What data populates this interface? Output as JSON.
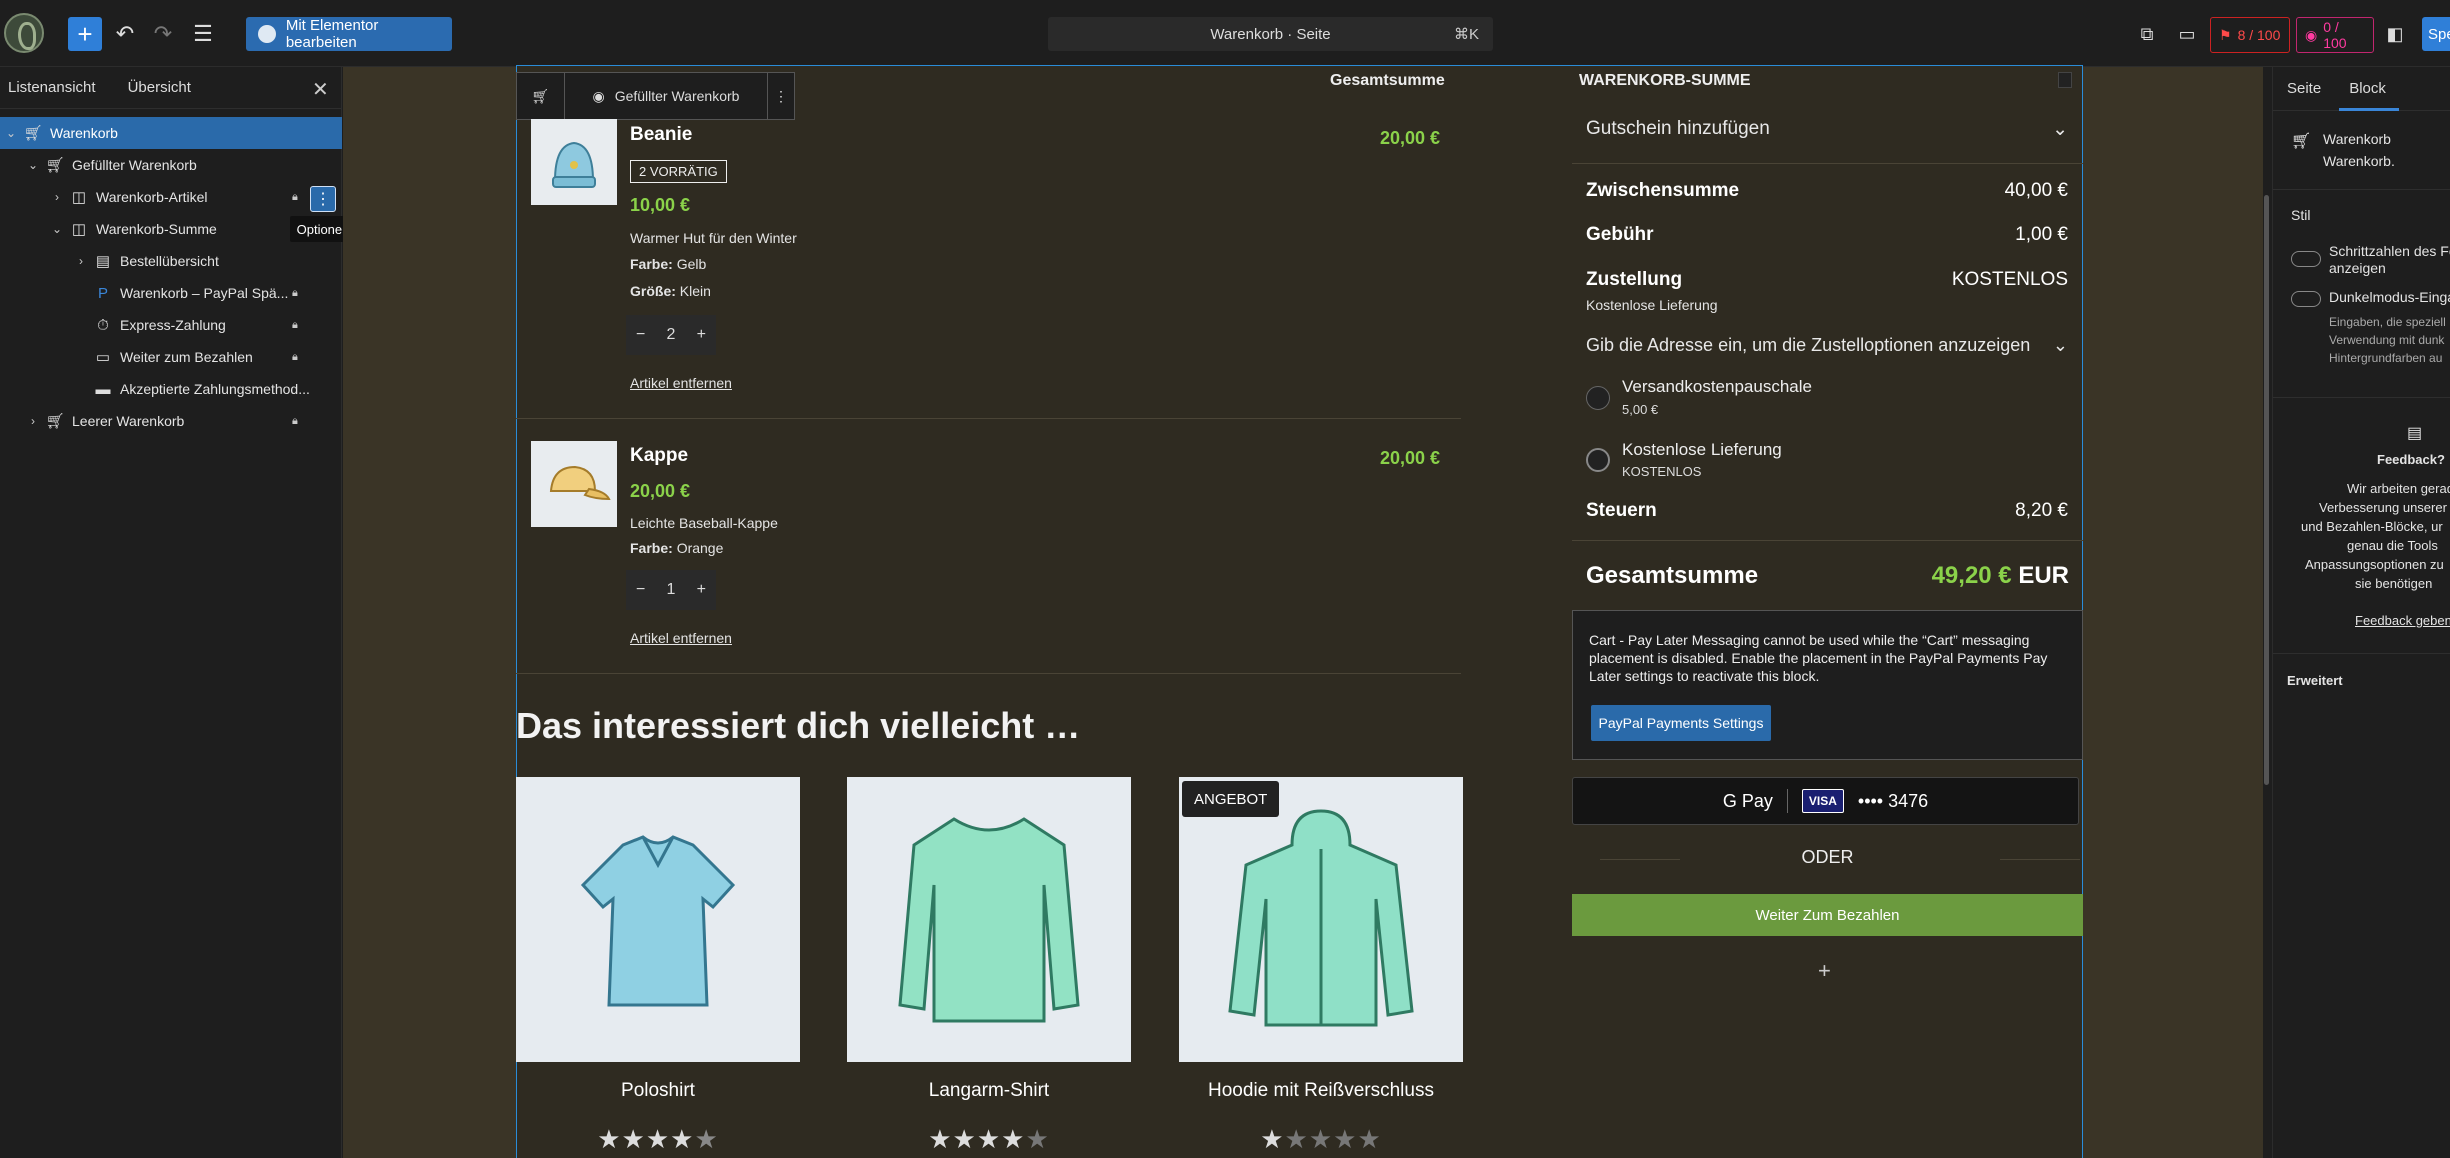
{
  "topbar": {
    "edit_button": "Mit Elementor bearbeiten",
    "document_title": "Warenkorb · Seite",
    "shortcut": "⌘K",
    "score_one": "8 / 100",
    "score_two": "0 / 100",
    "save_button": "Spe"
  },
  "left_sidebar": {
    "tab_list": "Listenansicht",
    "tab_overview": "Übersicht",
    "tooltip": "Optionen",
    "tree": [
      {
        "label": "Warenkorb"
      },
      {
        "label": "Gefüllter Warenkorb"
      },
      {
        "label": "Warenkorb-Artikel"
      },
      {
        "label": "Warenkorb-Summe"
      },
      {
        "label": "Bestellübersicht"
      },
      {
        "label": "Warenkorb – PayPal Spä..."
      },
      {
        "label": "Express-Zahlung"
      },
      {
        "label": "Weiter zum Bezahlen"
      },
      {
        "label": "Akzeptierte Zahlungsmethod..."
      },
      {
        "label": "Leerer Warenkorb"
      }
    ]
  },
  "block_toolbar": {
    "label": "Gefüllter Warenkorb"
  },
  "cart": {
    "column_total": "Gesamtsumme",
    "items": [
      {
        "name": "Beanie",
        "stock": "2 VORRÄTIG",
        "price": "10,00 €",
        "description": "Warmer Hut für den Winter",
        "attr1_label": "Farbe:",
        "attr1_value": "Gelb",
        "attr2_label": "Größe:",
        "attr2_value": "Klein",
        "qty": "2",
        "line_total": "20,00 €",
        "remove": "Artikel entfernen"
      },
      {
        "name": "Kappe",
        "price": "20,00 €",
        "description": "Leichte Baseball-Kappe",
        "attr1_label": "Farbe:",
        "attr1_value": "Orange",
        "qty": "1",
        "line_total": "20,00 €",
        "remove": "Artikel entfernen"
      }
    ]
  },
  "recommendations": {
    "title": "Das interessiert dich vielleicht …",
    "sale_badge": "ANGEBOT",
    "products": [
      {
        "name": "Poloshirt",
        "rating": 4.5
      },
      {
        "name": "Langarm-Shirt",
        "rating": 4
      },
      {
        "name": "Hoodie mit Reißverschluss",
        "rating": 1
      }
    ]
  },
  "totals": {
    "heading": "WARENKORB-SUMME",
    "coupon": "Gutschein hinzufügen",
    "subtotal_label": "Zwischensumme",
    "subtotal_value": "40,00 €",
    "fee_label": "Gebühr",
    "fee_value": "1,00 €",
    "shipping_label": "Zustellung",
    "shipping_value": "KOSTENLOS",
    "shipping_sub": "Kostenlose Lieferung",
    "address_prompt": "Gib die Adresse ein, um die Zustelloptionen anzuzeigen",
    "option1_label": "Versandkostenpauschale",
    "option1_price": "5,00 €",
    "option2_label": "Kostenlose Lieferung",
    "option2_price": "KOSTENLOS",
    "tax_label": "Steuern",
    "tax_value": "8,20 €",
    "grand_label": "Gesamtsumme",
    "grand_value": "49,20 €",
    "grand_currency": "EUR",
    "notice": "Cart - Pay Later Messaging cannot be used while the “Cart” messaging placement is disabled. Enable the placement in the PayPal Payments Pay Later settings to reactivate this block.",
    "paypal_settings": "PayPal Payments Settings",
    "gpay_label": "G Pay",
    "visa": "VISA",
    "card_digits": "•••• 3476",
    "or": "ODER",
    "checkout": "Weiter Zum Bezahlen"
  },
  "right_sidebar": {
    "tab_page": "Seite",
    "tab_block": "Block",
    "block_name": "Warenkorb",
    "block_desc": "Warenkorb.",
    "style_heading": "Stil",
    "toggle1": "Schrittzahlen des Fo",
    "toggle1b": "anzeigen",
    "toggle2": "Dunkelmodus-Einga",
    "help1": "Eingaben, die speziell",
    "help2": "Verwendung mit dunk",
    "help3": "Hintergrundfarben au",
    "feedback_title": "Feedback?",
    "fb1": "Wir arbeiten gerade",
    "fb2": "Verbesserung unserer V",
    "fb3": "und Bezahlen-Blöcke, ur",
    "fb4": "genau die Tools",
    "fb5": "Anpassungsoptionen zu",
    "fb6": "sie benötigen",
    "feedback_link": "Feedback geben",
    "advanced": "Erweitert"
  },
  "colors": {
    "accent": "#2f7fd8",
    "price_green": "#8bd24a",
    "checkout_green": "#6b9a3e"
  }
}
